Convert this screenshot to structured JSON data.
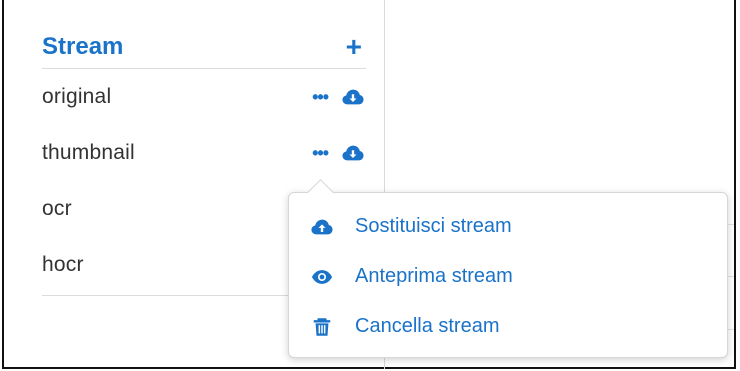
{
  "panel": {
    "title": "Stream",
    "add_icon": "plus-icon",
    "streams": [
      {
        "name": "original"
      },
      {
        "name": "thumbnail"
      },
      {
        "name": "ocr"
      },
      {
        "name": "hocr"
      }
    ],
    "more_icon": "ellipsis-icon",
    "download_icon": "cloud-download-icon"
  },
  "context_menu": {
    "items": [
      {
        "label": "Sostituisci stream",
        "icon": "cloud-upload-icon"
      },
      {
        "label": "Anteprima stream",
        "icon": "eye-icon"
      },
      {
        "label": "Cancella stream",
        "icon": "trash-icon"
      }
    ]
  },
  "colors": {
    "accent": "#1a73c9",
    "text": "#333333",
    "border": "#dcdcdc"
  }
}
